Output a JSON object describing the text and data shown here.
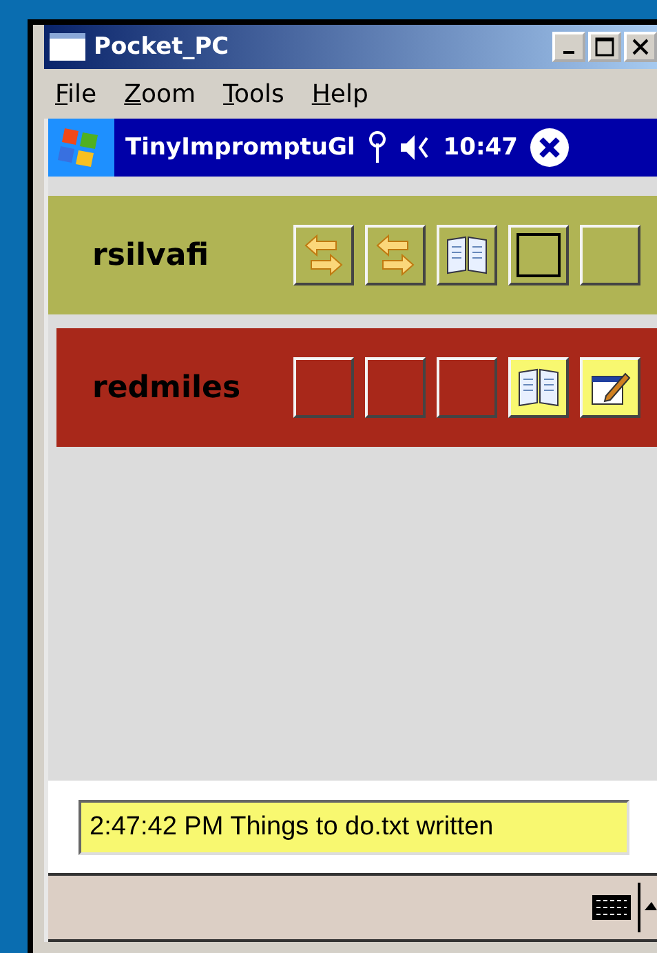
{
  "window": {
    "title": "Pocket_PC"
  },
  "menu": [
    "File",
    "Zoom",
    "Tools",
    "Help"
  ],
  "taskbar": {
    "app_title": "TinyImpromptuGl",
    "time": "10:47"
  },
  "users": [
    {
      "name": "rsilvafi",
      "color": "#b0b454",
      "buttons": [
        {
          "kind": "swap",
          "highlighted": false
        },
        {
          "kind": "swap",
          "highlighted": false
        },
        {
          "kind": "book",
          "highlighted": false
        },
        {
          "kind": "frame",
          "highlighted": false
        },
        {
          "kind": "blank",
          "highlighted": false
        }
      ]
    },
    {
      "name": "redmiles",
      "color": "#a8281a",
      "buttons": [
        {
          "kind": "blank",
          "highlighted": false
        },
        {
          "kind": "blank",
          "highlighted": false
        },
        {
          "kind": "blank",
          "highlighted": false
        },
        {
          "kind": "book",
          "highlighted": true
        },
        {
          "kind": "edit",
          "highlighted": true
        }
      ]
    }
  ],
  "status": "2:47:42 PM Things to do.txt written"
}
